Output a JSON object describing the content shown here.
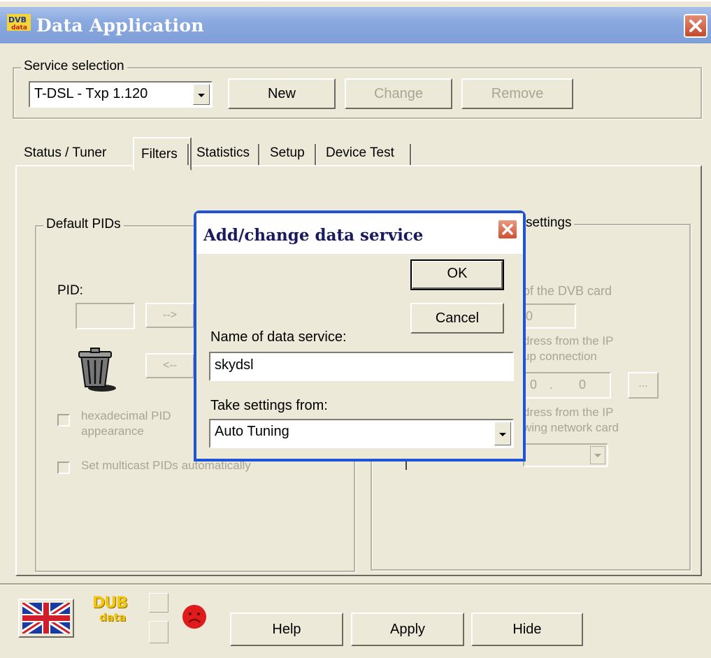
{
  "window": {
    "title": "Data Application"
  },
  "service_selection": {
    "legend": "Service selection",
    "selected": "T-DSL - Txp 1.120",
    "new_label": "New",
    "change_label": "Change",
    "remove_label": "Remove"
  },
  "tabs": [
    {
      "label": "Status / Tuner"
    },
    {
      "label": "Filters"
    },
    {
      "label": "Statistics"
    },
    {
      "label": "Setup"
    },
    {
      "label": "Device Test"
    }
  ],
  "filters": {
    "default_pids_legend": "Default PIDs",
    "pid_label": "PID:",
    "add_arrow": "-->",
    "remove_arrow": "<--",
    "hex_line1": "hexadecimal PID",
    "hex_line2": "appearance",
    "multicast_label": "Set multicast PIDs automatically"
  },
  "right_panel": {
    "legend_visible": "settings",
    "line1": "of the DVB card",
    "field1": "0",
    "line2": "dress from the IP",
    "line3": "up connection",
    "ip1": "0",
    "ip2": "0",
    "browse": "...",
    "line4": "dress from the IP",
    "line5": "wing network card"
  },
  "dialog": {
    "title": "Add/change data service",
    "ok_label": "OK",
    "cancel_label": "Cancel",
    "name_label": "Name of data service:",
    "name_value": "skydsl",
    "take_label": "Take settings from:",
    "take_value": "Auto Tuning"
  },
  "bottom": {
    "logo_line1": "DUB",
    "logo_line2": "data",
    "help_label": "Help",
    "apply_label": "Apply",
    "hide_label": "Hide"
  }
}
